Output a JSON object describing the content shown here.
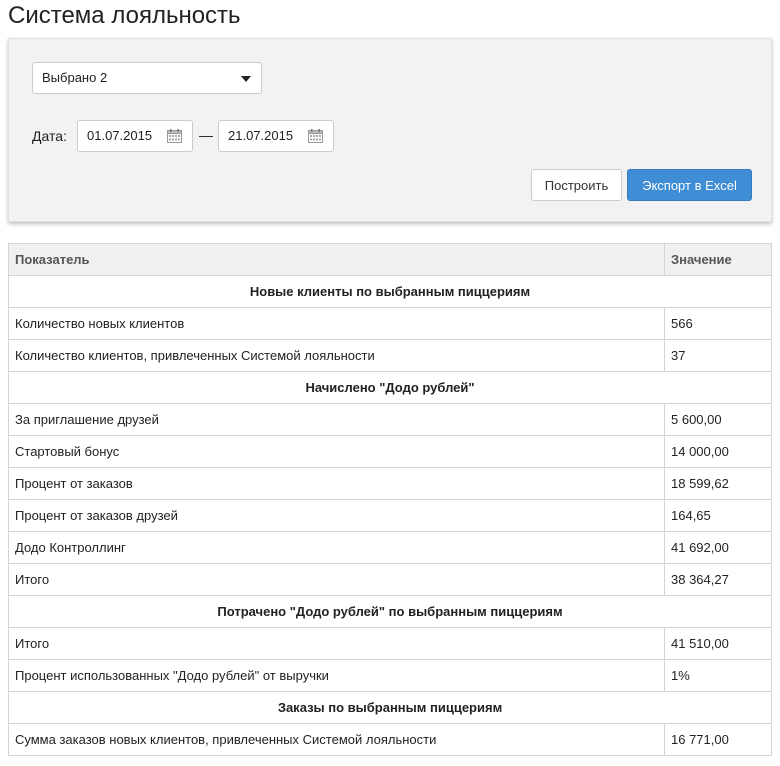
{
  "page": {
    "title": "Система лояльность"
  },
  "filters": {
    "select_value": "Выбрано 2",
    "date_label": "Дата:",
    "date_from": "01.07.2015",
    "date_separator": "—",
    "date_to": "21.07.2015",
    "build_label": "Построить",
    "export_label": "Экспорт в Excel"
  },
  "colors": {
    "accent": "#3f8dd5",
    "panel": "#f2f2f2"
  },
  "table": {
    "headers": [
      "Показатель",
      "Значение"
    ],
    "sections": [
      {
        "title": "Новые клиенты по выбранным пиццериям",
        "rows": [
          {
            "label": "Количество новых клиентов",
            "value": "566"
          },
          {
            "label": "Количество клиентов, привлеченных Системой лояльности",
            "value": "37"
          }
        ]
      },
      {
        "title": "Начислено \"Додо рублей\"",
        "rows": [
          {
            "label": "За приглашение друзей",
            "value": "5 600,00"
          },
          {
            "label": "Стартовый бонус",
            "value": "14 000,00"
          },
          {
            "label": "Процент от заказов",
            "value": "18 599,62"
          },
          {
            "label": "Процент от заказов друзей",
            "value": "164,65"
          },
          {
            "label": "Додо Контроллинг",
            "value": "41 692,00"
          },
          {
            "label": "Итого",
            "value": "38 364,27"
          }
        ]
      },
      {
        "title": "Потрачено \"Додо рублей\" по выбранным пиццериям",
        "rows": [
          {
            "label": "Итого",
            "value": "41 510,00"
          },
          {
            "label": "Процент использованных \"Додо рублей\" от выручки",
            "value": "1%"
          }
        ]
      },
      {
        "title": "Заказы по выбранным пиццериям",
        "rows": [
          {
            "label": "Сумма заказов новых клиентов, привлеченных Системой лояльности",
            "value": "16 771,00"
          }
        ]
      }
    ]
  }
}
